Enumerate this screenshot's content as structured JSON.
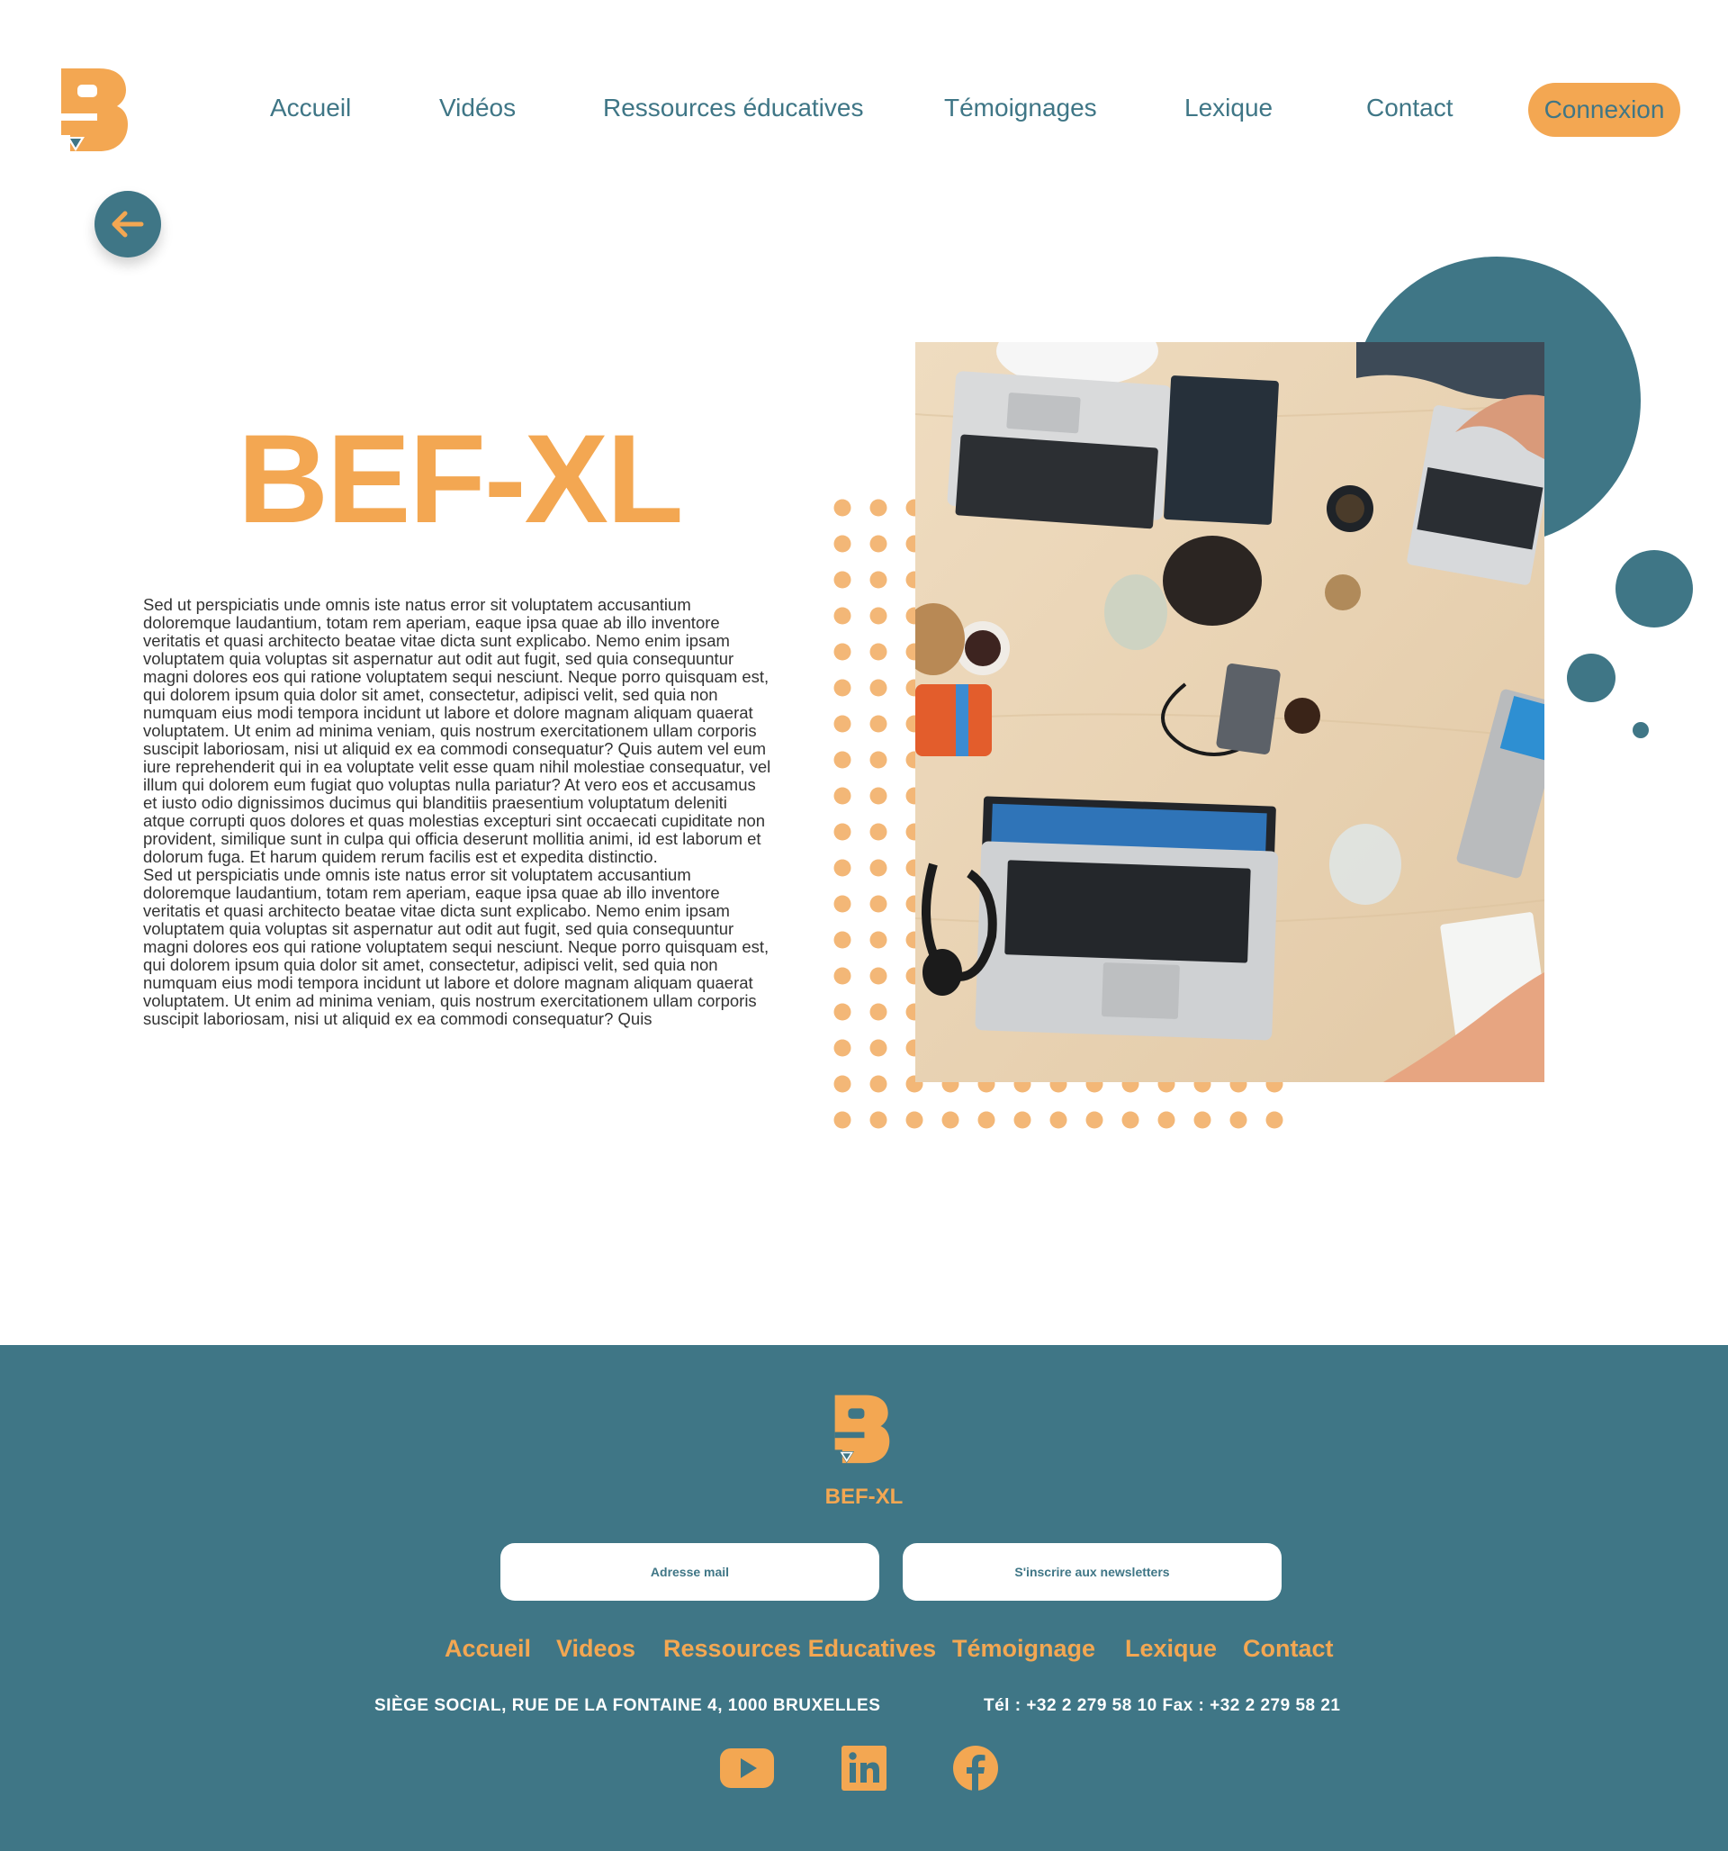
{
  "header": {
    "logo_icon": "bef-b-logo",
    "nav": [
      {
        "label": "Accueil"
      },
      {
        "label": "Vidéos"
      },
      {
        "label": "Ressources éducatives"
      },
      {
        "label": "Témoignages"
      },
      {
        "label": "Lexique"
      },
      {
        "label": "Contact"
      }
    ],
    "login_label": "Connexion"
  },
  "back_button": {
    "icon": "arrow-left-icon"
  },
  "hero": {
    "title": "BEF-XL",
    "paragraphs": [
      "Sed ut perspiciatis unde omnis iste natus error sit voluptatem accusantium doloremque laudantium, totam rem aperiam, eaque ipsa quae ab illo inventore veritatis et quasi architecto beatae vitae dicta sunt explicabo. Nemo enim ipsam voluptatem quia voluptas sit aspernatur aut odit aut fugit, sed quia consequuntur magni dolores eos qui ratione voluptatem sequi nesciunt. Neque porro quisquam est, qui dolorem ipsum quia dolor sit amet, consectetur, adipisci velit, sed quia non numquam eius modi tempora incidunt ut labore et dolore magnam aliquam quaerat voluptatem. Ut enim ad minima veniam, quis nostrum exercitationem ullam corporis suscipit laboriosam, nisi ut aliquid ex ea commodi consequatur? Quis autem vel eum iure reprehenderit qui in ea voluptate velit esse quam nihil molestiae consequatur, vel illum qui dolorem eum fugiat quo voluptas nulla pariatur? At vero eos et accusamus et iusto odio dignissimos ducimus qui blanditiis praesentium voluptatum deleniti atque corrupti quos dolores et quas molestias excepturi sint occaecati cupiditate non provident, similique sunt in culpa qui officia deserunt mollitia animi, id est laborum et dolorum fuga. Et harum quidem rerum facilis est et expedita distinctio.",
      "Sed ut perspiciatis unde omnis iste natus error sit voluptatem accusantium doloremque laudantium, totam rem aperiam, eaque ipsa quae ab illo inventore veritatis et quasi architecto beatae vitae dicta sunt explicabo. Nemo enim ipsam voluptatem quia voluptas sit aspernatur aut odit aut fugit, sed quia consequuntur magni dolores eos qui ratione voluptatem sequi nesciunt. Neque porro quisquam est, qui dolorem ipsum quia dolor sit amet, consectetur, adipisci velit, sed quia non numquam eius modi tempora incidunt ut labore et dolore magnam aliquam quaerat voluptatem. Ut enim ad minima veniam, quis nostrum exercitationem ullam corporis suscipit laboriosam, nisi ut aliquid ex ea commodi consequatur? Quis"
    ],
    "photo": "laptops-on-desk-photo"
  },
  "footer": {
    "logo_text": "BEF-XL",
    "email_label": "Adresse mail",
    "newsletter_label": "S'inscrire aux newsletters",
    "nav": [
      {
        "label": "Accueil"
      },
      {
        "label": "Videos"
      },
      {
        "label": "Ressources Educatives"
      },
      {
        "label": "Témoignage"
      },
      {
        "label": "Lexique"
      },
      {
        "label": "Contact"
      }
    ],
    "address": "SIÈGE SOCIAL, RUE DE LA FONTAINE 4, 1000 BRUXELLES",
    "phone": "Tél : +32 2 279 58 10 Fax : +32 2 279 58 21",
    "social": [
      "youtube-icon",
      "linkedin-icon",
      "facebook-icon"
    ]
  },
  "colors": {
    "accent": "#f3a752",
    "primary": "#3f7686",
    "background": "#ffffff"
  }
}
